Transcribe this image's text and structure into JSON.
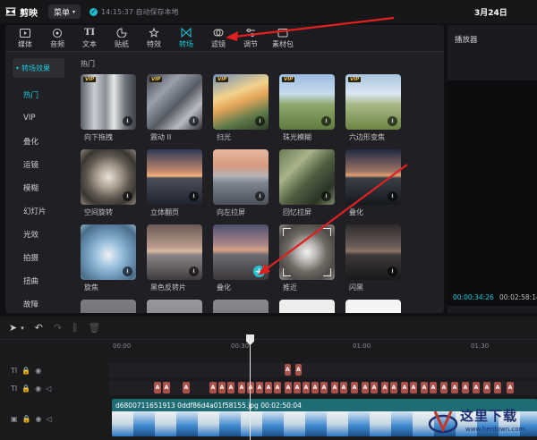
{
  "app": {
    "name": "剪映",
    "menu_label": "菜单",
    "save_status": "14:15:37 自动保存本地",
    "project_name": "3月24日"
  },
  "tabs": [
    {
      "label": "媒体",
      "icon": "media-icon"
    },
    {
      "label": "音频",
      "icon": "audio-icon"
    },
    {
      "label": "文本",
      "icon": "text-icon"
    },
    {
      "label": "贴纸",
      "icon": "sticker-icon"
    },
    {
      "label": "特效",
      "icon": "effects-icon"
    },
    {
      "label": "转场",
      "icon": "transition-icon",
      "active": true
    },
    {
      "label": "滤镜",
      "icon": "filter-icon"
    },
    {
      "label": "调节",
      "icon": "adjust-icon"
    },
    {
      "label": "素材包",
      "icon": "package-icon"
    }
  ],
  "sidebar": {
    "header": "转场效果",
    "items": [
      "热门",
      "VIP",
      "叠化",
      "运镜",
      "模糊",
      "幻灯片",
      "光效",
      "拍摄",
      "扭曲",
      "故障"
    ]
  },
  "section_title": "热门",
  "cards": [
    {
      "label": "向下拖拽",
      "vip": true
    },
    {
      "label": "震动 II",
      "vip": true
    },
    {
      "label": "扫光",
      "vip": true
    },
    {
      "label": "珠光模糊",
      "vip": true
    },
    {
      "label": "六边形变焦",
      "vip": true
    },
    {
      "label": "空间旋转",
      "vip": false
    },
    {
      "label": "立体翻页",
      "vip": false
    },
    {
      "label": "向左拉屏",
      "vip": false
    },
    {
      "label": "回忆拉屏",
      "vip": false
    },
    {
      "label": "叠化",
      "vip": false
    },
    {
      "label": "旋焦",
      "vip": false
    },
    {
      "label": "黑色反转片",
      "vip": false
    },
    {
      "label": "叠化",
      "vip": false
    },
    {
      "label": "推近",
      "vip": false
    },
    {
      "label": "闪黑",
      "vip": false
    }
  ],
  "vip_badge": "VIP",
  "player": {
    "title": "播放器",
    "current_time": "00:00:34:26",
    "total_time": "00:02:58:14"
  },
  "timeline": {
    "ruler": [
      "00:00",
      "00:30",
      "01:00",
      "01:30"
    ],
    "video_clip_title": "d6800711651913 0ddf86d4a01f58155.jpg 00:02:50:04",
    "clip_label": "A"
  },
  "watermark": {
    "title": "这里下载",
    "url": "www.herdown.com"
  }
}
